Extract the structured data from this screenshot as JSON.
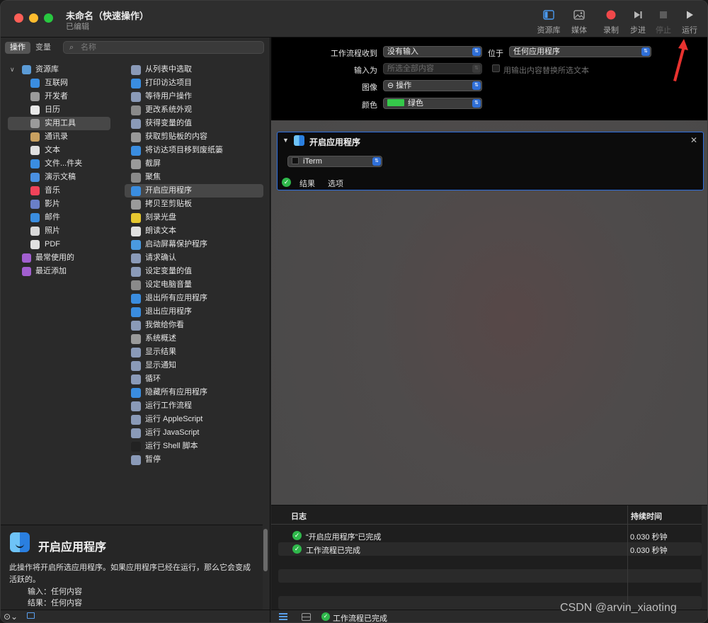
{
  "window": {
    "title": "未命名（快速操作）",
    "subtitle": "已编辑"
  },
  "toolbar": {
    "library": "资源库",
    "media": "媒体",
    "record": "录制",
    "step": "步进",
    "stop": "停止",
    "run": "运行"
  },
  "sidebar": {
    "tabs": [
      "操作",
      "变量"
    ],
    "search_placeholder": "名称",
    "library": [
      {
        "label": "资源库",
        "color": "#5b9bd6"
      },
      {
        "label": "互联网",
        "color": "#3a8de0"
      },
      {
        "label": "开发者",
        "color": "#9a9a9a"
      },
      {
        "label": "日历",
        "color": "#e8e8e8"
      },
      {
        "label": "实用工具",
        "color": "#9a9a9a"
      },
      {
        "label": "通讯录",
        "color": "#c8a060"
      },
      {
        "label": "文本",
        "color": "#e0e0e0"
      },
      {
        "label": "文件...件夹",
        "color": "#3a8de0"
      },
      {
        "label": "演示文稿",
        "color": "#4a90e2"
      },
      {
        "label": "音乐",
        "color": "#f0435a"
      },
      {
        "label": "影片",
        "color": "#6a7fc8"
      },
      {
        "label": "邮件",
        "color": "#3a8de0"
      },
      {
        "label": "照片",
        "color": "#d8d8d8"
      },
      {
        "label": "PDF",
        "color": "#e0e0e0"
      },
      {
        "label": "最常使用的",
        "color": "#a25fd0"
      },
      {
        "label": "最近添加",
        "color": "#a25fd0"
      }
    ],
    "actions": [
      {
        "label": "从列表中选取",
        "color": "#8a9ab8"
      },
      {
        "label": "打印访达项目",
        "color": "#3a8de0"
      },
      {
        "label": "等待用户操作",
        "color": "#8a9ab8"
      },
      {
        "label": "更改系统外观",
        "color": "#8a8a8a"
      },
      {
        "label": "获得变量的值",
        "color": "#8a9ab8"
      },
      {
        "label": "获取剪贴板的内容",
        "color": "#9a9a9a"
      },
      {
        "label": "将访达项目移到废纸篓",
        "color": "#3a8de0"
      },
      {
        "label": "截屏",
        "color": "#9a9a9a"
      },
      {
        "label": "聚焦",
        "color": "#8a8a8a"
      },
      {
        "label": "开启应用程序",
        "color": "#3a8de0"
      },
      {
        "label": "拷贝至剪贴板",
        "color": "#9a9a9a"
      },
      {
        "label": "刻录光盘",
        "color": "#e6c830"
      },
      {
        "label": "朗读文本",
        "color": "#e0e0e0"
      },
      {
        "label": "启动屏幕保护程序",
        "color": "#4a9ae0"
      },
      {
        "label": "请求确认",
        "color": "#8a9ab8"
      },
      {
        "label": "设定变量的值",
        "color": "#8a9ab8"
      },
      {
        "label": "设定电脑音量",
        "color": "#8a8a8a"
      },
      {
        "label": "退出所有应用程序",
        "color": "#3a8de0"
      },
      {
        "label": "退出应用程序",
        "color": "#3a8de0"
      },
      {
        "label": "我做给你看",
        "color": "#8a9ab8"
      },
      {
        "label": "系统概述",
        "color": "#9a9a9a"
      },
      {
        "label": "显示结果",
        "color": "#8a9ab8"
      },
      {
        "label": "显示通知",
        "color": "#8a9ab8"
      },
      {
        "label": "循环",
        "color": "#8a9ab8"
      },
      {
        "label": "隐藏所有应用程序",
        "color": "#3a8de0"
      },
      {
        "label": "运行工作流程",
        "color": "#8a9ab8"
      },
      {
        "label": "运行 AppleScript",
        "color": "#8a9ab8"
      },
      {
        "label": "运行 JavaScript",
        "color": "#8a9ab8"
      },
      {
        "label": "运行 Shell 脚本",
        "color": "#222222"
      },
      {
        "label": "暂停",
        "color": "#8a9ab8"
      }
    ]
  },
  "description": {
    "title": "开启应用程序",
    "text": "此操作将开启所选应用程序。如果应用程序已经在运行，那么它会变成活跃的。",
    "input": "输入：任何内容",
    "result": "结果：任何内容"
  },
  "settings": {
    "receives_label": "工作流程收到",
    "receives_value": "没有输入",
    "in_label": "位于",
    "in_value": "任何应用程序",
    "input_is_label": "输入为",
    "input_is_value": "所选全部内容",
    "replace_label": "用输出内容替换所选文本",
    "image_label": "图像",
    "image_value": "⊖ 操作",
    "color_label": "颜色",
    "color_value": "绿色",
    "color_swatch": "#35c94a"
  },
  "action_card": {
    "title": "开启应用程序",
    "app": "iTerm",
    "results": "结果",
    "options": "选项"
  },
  "log": {
    "col_log": "日志",
    "col_duration": "持续时间",
    "rows": [
      {
        "msg": "“开启应用程序”已完成",
        "dur": "0.030 秒钟"
      },
      {
        "msg": "工作流程已完成",
        "dur": "0.030 秒钟"
      }
    ]
  },
  "status": {
    "text": "工作流程已完成"
  },
  "watermark": "CSDN @arvin_xiaoting"
}
